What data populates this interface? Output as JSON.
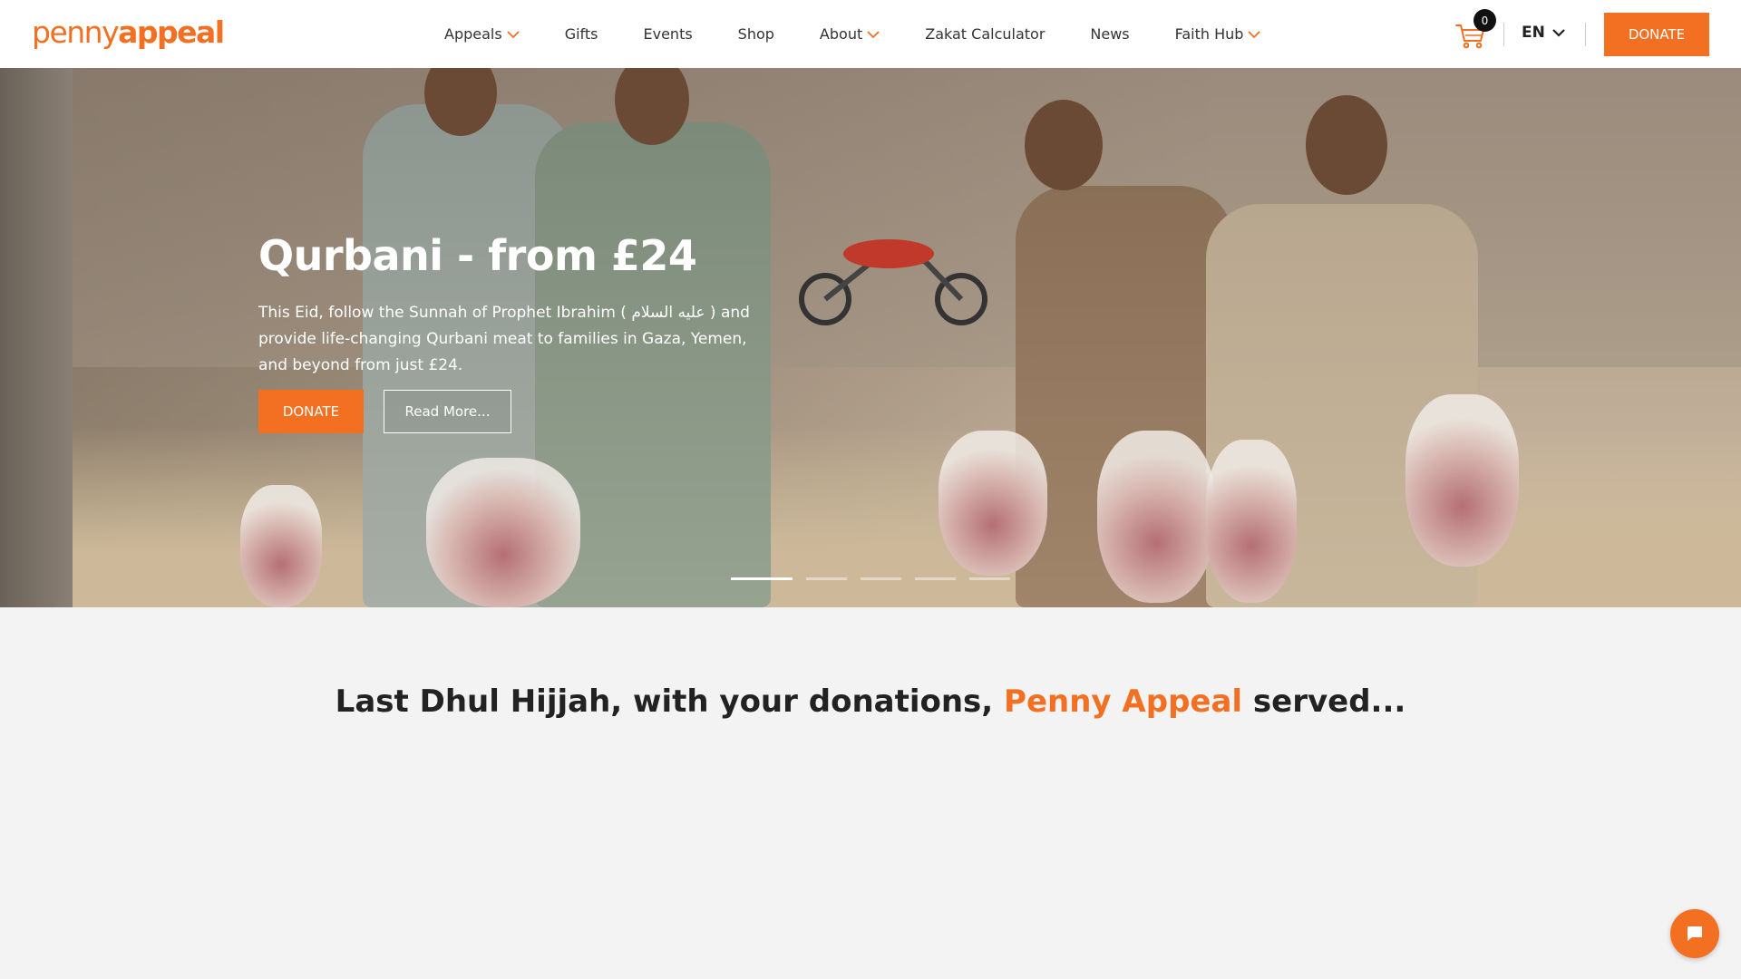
{
  "brand": {
    "logo_part1": "penny",
    "logo_part2": "appeal",
    "accent_color": "#f36f21"
  },
  "nav": {
    "items": [
      {
        "label": "Appeals",
        "has_dropdown": true
      },
      {
        "label": "Gifts",
        "has_dropdown": false
      },
      {
        "label": "Events",
        "has_dropdown": false
      },
      {
        "label": "Shop",
        "has_dropdown": false
      },
      {
        "label": "About",
        "has_dropdown": true
      },
      {
        "label": "Zakat Calculator",
        "has_dropdown": false
      },
      {
        "label": "News",
        "has_dropdown": false
      },
      {
        "label": "Faith Hub",
        "has_dropdown": true
      }
    ]
  },
  "header": {
    "cart_count": "0",
    "cart_icon": "shopping-cart-icon",
    "language": "EN",
    "donate_label": "DONATE"
  },
  "hero": {
    "title": "Qurbani - from £24",
    "text": "This Eid, follow the Sunnah of Prophet Ibrahim ( عليه السلام ) and provide life-changing Qurbani meat to families in Gaza, Yemen, and beyond from just £24.",
    "donate_label": "DONATE",
    "read_more_label": "Read More...",
    "slides_total": 5,
    "active_slide": 1
  },
  "stats": {
    "heading_prefix": "Last Dhul Hijjah, with your donations, ",
    "heading_accent": "Penny Appeal",
    "heading_suffix": " served..."
  },
  "chat": {
    "icon": "chat-bubble-icon"
  }
}
